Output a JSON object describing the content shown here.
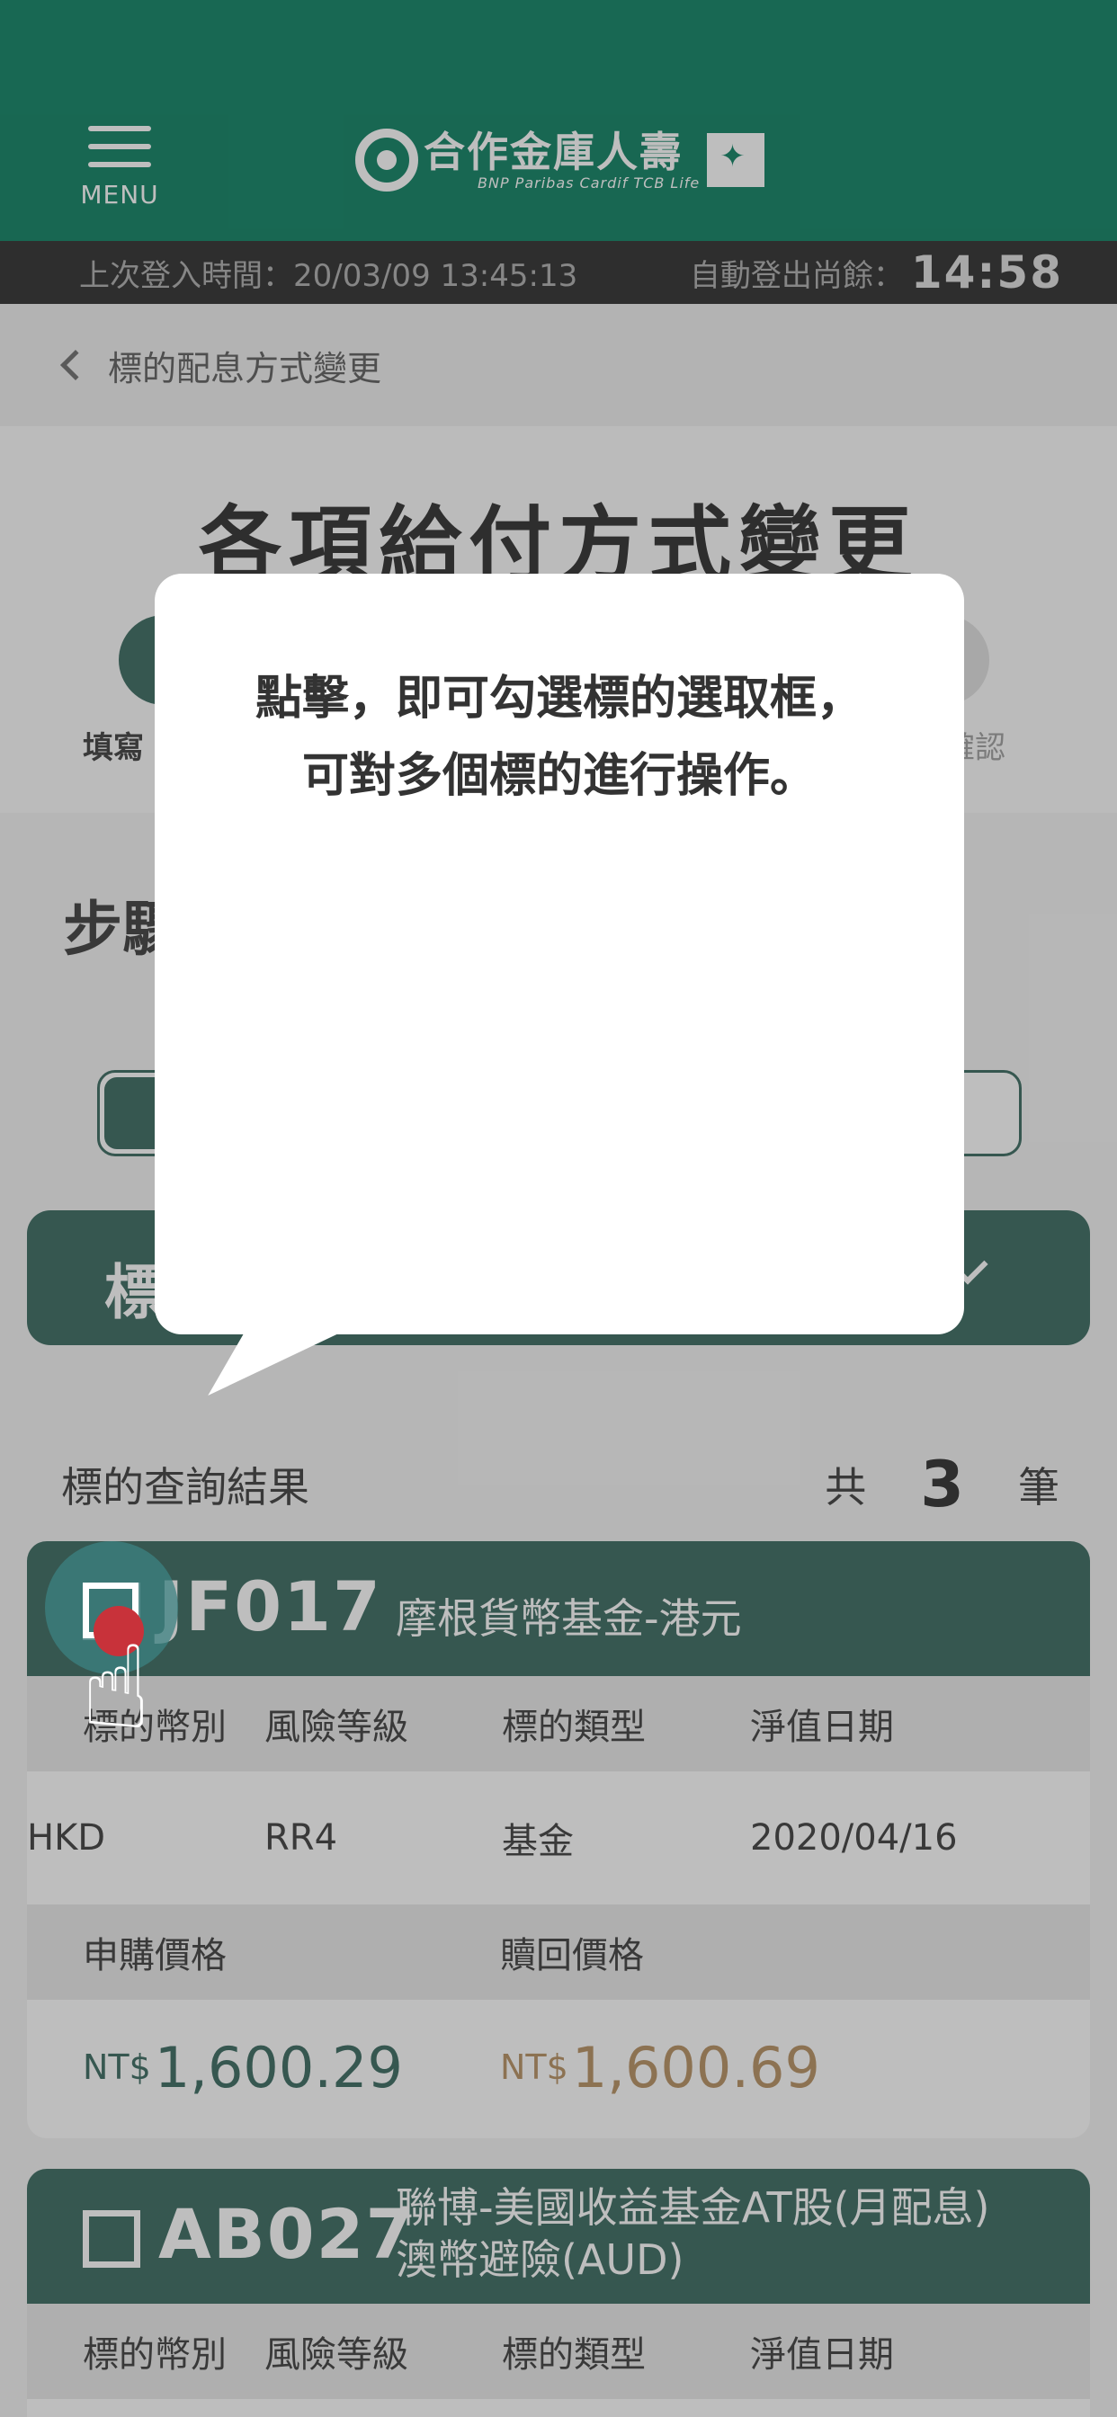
{
  "header": {
    "menu_label": "MENU",
    "logo_cn": "合作金庫人壽",
    "logo_en": "BNP Paribas Cardif TCB Life"
  },
  "session": {
    "last_login_label": "上次登入時間：20/03/09 13:45:13",
    "auto_logout_label": "自動登出尚餘：",
    "countdown": "14:58"
  },
  "breadcrumb": {
    "label": "標的配息方式變更"
  },
  "page": {
    "title": "各項給付方式變更",
    "step_left": "填寫",
    "step_right": "確認",
    "step_heading": "步驟",
    "filter_label": "標"
  },
  "tooltip": {
    "line1": "點擊，即可勾選標的選取框，",
    "line2": "可對多個標的進行操作。"
  },
  "results": {
    "title": "標的查詢結果",
    "count_prefix": "共",
    "count": "3",
    "count_suffix": "筆"
  },
  "card_labels": {
    "currency": "標的幣別",
    "risk": "風險等級",
    "type": "標的類型",
    "nav_date": "淨值日期",
    "buy_price": "申購價格",
    "sell_price": "贖回價格"
  },
  "funds": [
    {
      "code": "JF017",
      "name": "摩根貨幣基金-港元",
      "currency": "HKD",
      "risk": "RR4",
      "type": "基金",
      "nav_date": "2020/04/16",
      "buy_currency": "NT$",
      "buy_amount": "1,600.29",
      "sell_currency": "NT$",
      "sell_amount": "1,600.69"
    },
    {
      "code": "AB027",
      "name_line1": "聯博-美國收益基金AT股(月配息)",
      "name_line2": "澳幣避險(AUD)"
    }
  ],
  "colors": {
    "header_green": "#007a5a",
    "card_green": "#2f6157",
    "sell_price": "#b38a5a",
    "tap_red": "#c8323a"
  }
}
